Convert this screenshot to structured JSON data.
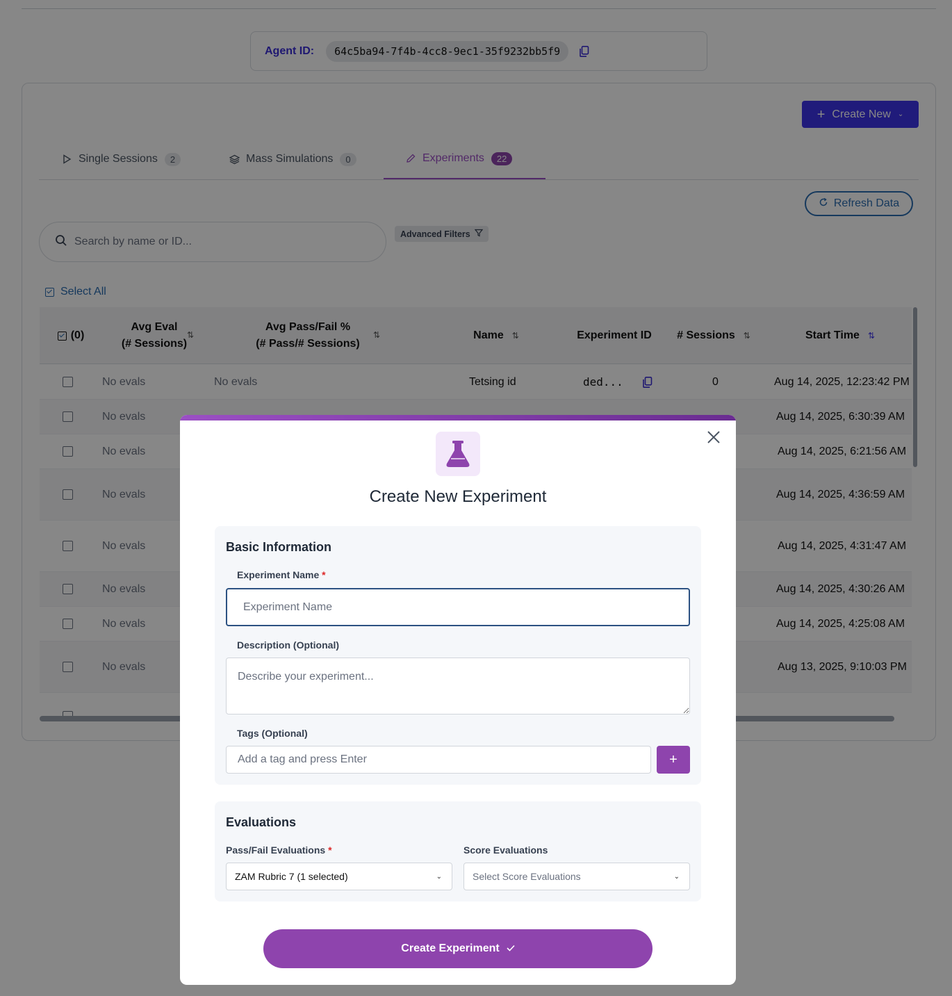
{
  "agent": {
    "label": "Agent ID:",
    "id": "64c5ba94-7f4b-4cc8-9ec1-35f9232bb5f9"
  },
  "header": {
    "create_new_label": "Create New"
  },
  "tabs": [
    {
      "label": "Single Sessions",
      "count": "2"
    },
    {
      "label": "Mass Simulations",
      "count": "0"
    },
    {
      "label": "Experiments",
      "count": "22"
    }
  ],
  "toolbar": {
    "refresh_label": "Refresh Data",
    "search_placeholder": "Search by name or ID...",
    "advanced_filters_label": "Advanced Filters",
    "select_all_label": "Select All"
  },
  "table": {
    "columns": {
      "select": "(0)",
      "avg_eval_line1": "Avg Eval",
      "avg_eval_line2": "(# Sessions)",
      "avg_pass_line1": "Avg Pass/Fail %",
      "avg_pass_line2": "(# Pass/# Sessions)",
      "name": "Name",
      "experiment_id": "Experiment ID",
      "sessions": "# Sessions",
      "start_time": "Start Time"
    },
    "rows": [
      {
        "avg_eval": "No evals",
        "avg_pass": "No evals",
        "name": "Tetsing id",
        "experiment_id": "ded...",
        "sessions": "0",
        "start_time": "Aug 14, 2025, 12:23:42 PM"
      },
      {
        "avg_eval": "No evals",
        "start_time": "Aug 14, 2025, 6:30:39 AM"
      },
      {
        "avg_eval": "No evals",
        "start_time": "Aug 14, 2025, 6:21:56 AM"
      },
      {
        "avg_eval": "No evals",
        "start_time": "Aug 14, 2025, 4:36:59 AM"
      },
      {
        "avg_eval": "No evals",
        "start_time": "Aug 14, 2025, 4:31:47 AM"
      },
      {
        "avg_eval": "No evals",
        "start_time": "Aug 14, 2025, 4:30:26 AM"
      },
      {
        "avg_eval": "No evals",
        "start_time": "Aug 14, 2025, 4:25:08 AM"
      },
      {
        "avg_eval": "No evals",
        "start_time": "Aug 13, 2025, 9:10:03 PM"
      }
    ]
  },
  "modal": {
    "title": "Create New Experiment",
    "basic_info_title": "Basic Information",
    "name_label": "Experiment Name",
    "name_placeholder": "Experiment Name",
    "required_mark": "*",
    "description_label": "Description (Optional)",
    "description_placeholder": "Describe your experiment...",
    "tags_label": "Tags (Optional)",
    "tags_placeholder": "Add a tag and press Enter",
    "tag_add_label": "+",
    "evaluations_title": "Evaluations",
    "pass_fail_label": "Pass/Fail Evaluations",
    "pass_fail_value": "ZAM Rubric 7 (1 selected)",
    "score_label": "Score Evaluations",
    "score_placeholder": "Select Score Evaluations",
    "submit_label": "Create Experiment"
  },
  "colors": {
    "primary_blue": "#3d33e8",
    "accent_purple": "#8e44ad",
    "link_blue": "#2b6cb0"
  }
}
